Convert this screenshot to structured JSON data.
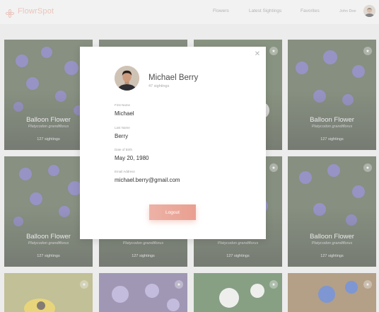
{
  "header": {
    "logo_text": "FlowrSpot",
    "nav": [
      "Flowers",
      "Latest Sightings",
      "Favorites",
      "John Doe"
    ]
  },
  "cards": [
    {
      "title": "Balloon Flower",
      "latin": "Platycodon grandiflorus",
      "sightings": "127 sightings"
    },
    {
      "title": "",
      "latin": "",
      "sightings": ""
    },
    {
      "title": "",
      "latin": "",
      "sightings": ""
    },
    {
      "title": "Balloon Flower",
      "latin": "Platycodon grandiflorus",
      "sightings": "127 sightings"
    },
    {
      "title": "Balloon Flower",
      "latin": "Platycodon grandiflorus",
      "sightings": "127 sightings"
    },
    {
      "title": "",
      "latin": "Platycodon grandiflorus",
      "sightings": "127 sightings"
    },
    {
      "title": "",
      "latin": "Platycodon grandiflorus",
      "sightings": "127 sightings"
    },
    {
      "title": "Balloon Flower",
      "latin": "Platycodon grandiflorus",
      "sightings": "127 sightings"
    }
  ],
  "modal": {
    "name": "Michael Berry",
    "sightings": "47 sightings",
    "fields": [
      {
        "label": "First Name",
        "value": "Michael"
      },
      {
        "label": "Last Name",
        "value": "Berry"
      },
      {
        "label": "Date of Birth",
        "value": "May 20, 1980"
      },
      {
        "label": "Email Address",
        "value": "michael.berry@gmail.com"
      }
    ],
    "logout_label": "Logout"
  },
  "colors": {
    "brand": "#e8a99b",
    "button": "#ea a596"
  },
  "icons": {
    "logo": "flower-logo-icon",
    "close": "close-icon",
    "favorite": "star-icon"
  }
}
